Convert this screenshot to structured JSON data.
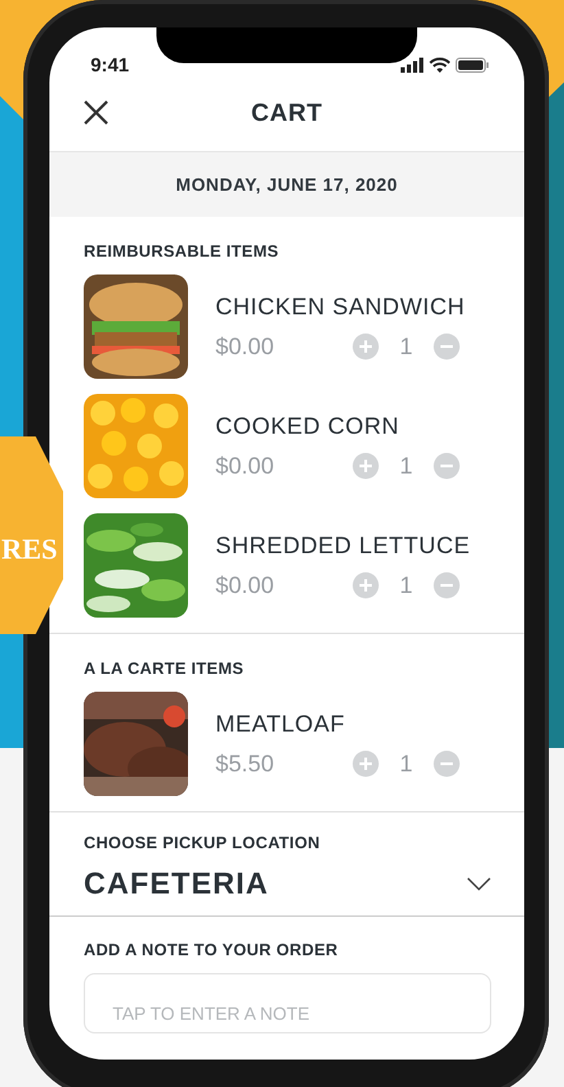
{
  "badge": {
    "text": "RES"
  },
  "status_bar": {
    "time": "9:41"
  },
  "header": {
    "title": "CART"
  },
  "date": "MONDAY, JUNE 17, 2020",
  "sections": [
    {
      "title": "REIMBURSABLE ITEMS",
      "items": [
        {
          "name": "CHICKEN SANDWICH",
          "price": "$0.00",
          "quantity": "1"
        },
        {
          "name": "COOKED CORN",
          "price": "$0.00",
          "quantity": "1"
        },
        {
          "name": "SHREDDED LETTUCE",
          "price": "$0.00",
          "quantity": "1"
        }
      ]
    },
    {
      "title": "A LA CARTE ITEMS",
      "items": [
        {
          "name": "MEATLOAF",
          "price": "$5.50",
          "quantity": "1"
        }
      ]
    }
  ],
  "pickup": {
    "label": "CHOOSE PICKUP LOCATION",
    "value": "CAFETERIA"
  },
  "note": {
    "label": "ADD A NOTE TO YOUR ORDER",
    "placeholder": "TAP TO ENTER A NOTE"
  }
}
